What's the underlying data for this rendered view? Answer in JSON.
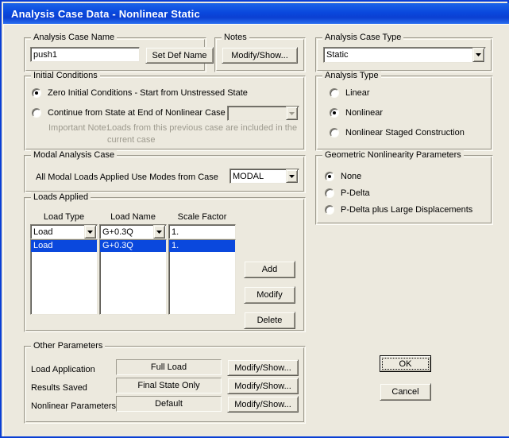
{
  "window": {
    "title": "Analysis Case Data - Nonlinear Static",
    "accent_color": "#0a48dd",
    "face_color": "#ece9de",
    "selection_color": "#0a48dd"
  },
  "analysis_case_name": {
    "group_label": "Analysis Case Name",
    "value": "push1",
    "placeholder": "",
    "set_def_name_button": "Set Def Name"
  },
  "notes": {
    "group_label": "Notes",
    "modify_show_button": "Modify/Show..."
  },
  "analysis_case_type": {
    "group_label": "Analysis Case Type",
    "selected": "Static",
    "options": [
      "Static"
    ]
  },
  "initial_conditions": {
    "group_label": "Initial Conditions",
    "zero_option": "Zero Initial Conditions - Start from Unstressed State",
    "continue_option": "Continue from State at End of Nonlinear Case",
    "selected": "zero",
    "continue_case_value": "",
    "note_label": "Important Note:",
    "note_line1": "Loads from this previous case are included in the",
    "note_line2": "current case"
  },
  "analysis_type": {
    "group_label": "Analysis Type",
    "options": [
      "Linear",
      "Nonlinear",
      "Nonlinear Staged Construction"
    ],
    "selected_index": 1
  },
  "modal_analysis_case": {
    "group_label": "Modal Analysis Case",
    "label": "All Modal Loads Applied Use Modes from Case",
    "selected": "MODAL",
    "options": [
      "MODAL"
    ]
  },
  "geometric_nonlinearity": {
    "group_label": "Geometric Nonlinearity Parameters",
    "options": [
      "None",
      "P-Delta",
      "P-Delta plus Large Displacements"
    ],
    "selected_index": 0
  },
  "loads_applied": {
    "group_label": "Loads Applied",
    "columns": [
      "Load Type",
      "Load Name",
      "Scale Factor"
    ],
    "editor": {
      "load_type": "Load",
      "load_name": "G+0.3Q",
      "scale_factor": "1."
    },
    "rows": [
      {
        "load_type": "Load",
        "load_name": "G+0.3Q",
        "scale_factor": "1.",
        "selected": true
      }
    ],
    "buttons": {
      "add": "Add",
      "modify": "Modify",
      "delete": "Delete"
    }
  },
  "other_parameters": {
    "group_label": "Other Parameters",
    "rows": [
      {
        "label": "Load Application",
        "value": "Full Load",
        "button": "Modify/Show..."
      },
      {
        "label": "Results Saved",
        "value": "Final State Only",
        "button": "Modify/Show..."
      },
      {
        "label": "Nonlinear Parameters",
        "value": "Default",
        "button": "Modify/Show..."
      }
    ]
  },
  "dialog_buttons": {
    "ok": "OK",
    "cancel": "Cancel"
  }
}
